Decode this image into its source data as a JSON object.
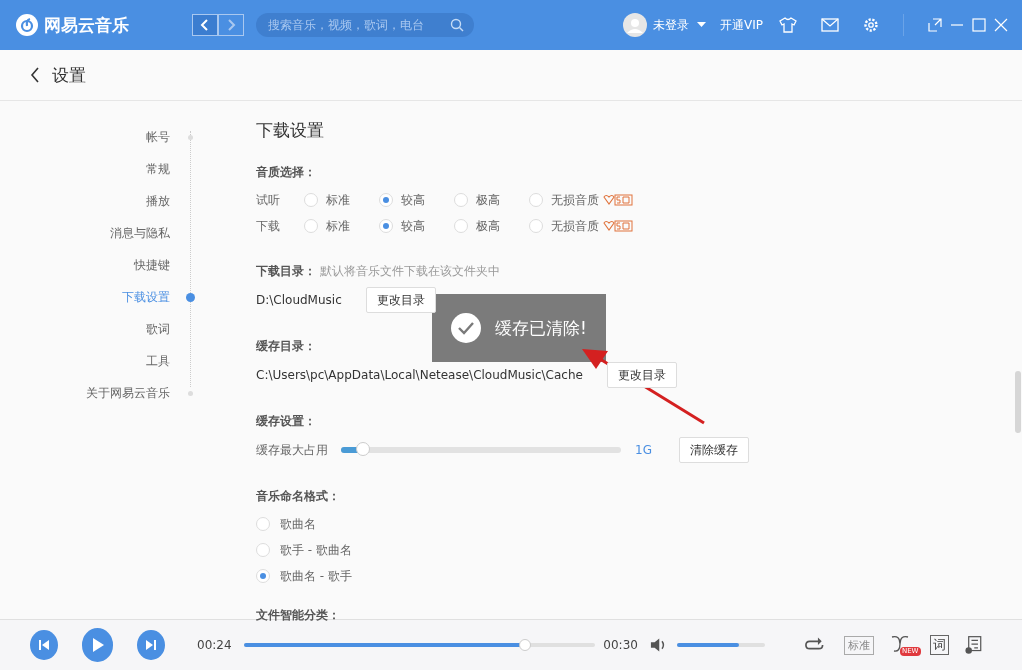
{
  "app": {
    "title": "网易云音乐",
    "search": {
      "placeholder": "搜索音乐，视频，歌词，电台"
    },
    "user": "未登录",
    "vip": "开通VIP"
  },
  "page": {
    "title": "设置"
  },
  "nav": [
    {
      "label": "帐号",
      "selected": false
    },
    {
      "label": "常规",
      "selected": false
    },
    {
      "label": "播放",
      "selected": false
    },
    {
      "label": "消息与隐私",
      "selected": false
    },
    {
      "label": "快捷键",
      "selected": false
    },
    {
      "label": "下载设置",
      "selected": true
    },
    {
      "label": "歌词",
      "selected": false
    },
    {
      "label": "工具",
      "selected": false
    },
    {
      "label": "关于网易云音乐",
      "selected": false
    }
  ],
  "section_title": "下载设置",
  "quality": {
    "label": "音质选择：",
    "rows": [
      {
        "name": "试听",
        "options": [
          {
            "label": "标准",
            "selected": false,
            "badge": false
          },
          {
            "label": "较高",
            "selected": true,
            "badge": false
          },
          {
            "label": "极高",
            "selected": false,
            "badge": false
          },
          {
            "label": "无损音质",
            "selected": false,
            "badge": true
          }
        ]
      },
      {
        "name": "下载",
        "options": [
          {
            "label": "标准",
            "selected": false,
            "badge": false
          },
          {
            "label": "较高",
            "selected": true,
            "badge": false
          },
          {
            "label": "极高",
            "selected": false,
            "badge": false
          },
          {
            "label": "无损音质",
            "selected": false,
            "badge": true
          }
        ]
      }
    ]
  },
  "download_dir": {
    "label": "下载目录：",
    "hint": "默认将音乐文件下载在该文件夹中",
    "path": "D:\\CloudMusic",
    "button": "更改目录"
  },
  "cache_dir": {
    "label": "缓存目录：",
    "path": "C:\\Users\\pc\\AppData\\Local\\Netease\\CloudMusic\\Cache",
    "button": "更改目录"
  },
  "cache": {
    "label": "缓存设置：",
    "slider_label": "缓存最大占用",
    "level": 0.08,
    "reading": "1G",
    "button": "清除缓存"
  },
  "naming": {
    "label": "音乐命名格式：",
    "options": [
      {
        "label": "歌曲名",
        "selected": false
      },
      {
        "label": "歌手 - 歌曲名",
        "selected": false
      },
      {
        "label": "歌曲名 - 歌手",
        "selected": true
      }
    ]
  },
  "next_section": "文件智能分类：",
  "toast": "缓存已清除!",
  "player": {
    "elapsed": "00:24",
    "progress": {
      "level": 0.8
    },
    "total": "00:30",
    "volume": {
      "level": 0.7
    },
    "quality": "标准",
    "new_badge": "NEW",
    "lyrics": "词"
  }
}
